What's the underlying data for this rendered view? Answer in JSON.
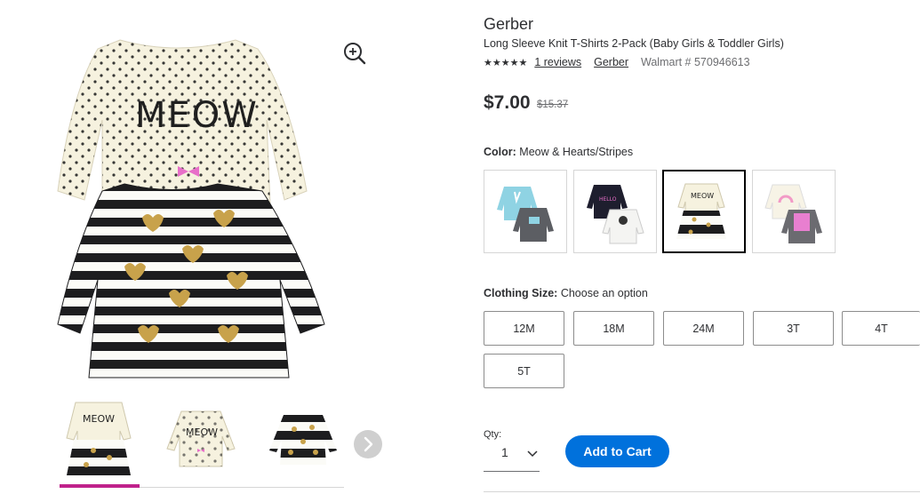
{
  "product": {
    "brand": "Gerber",
    "title": "Long Sleeve Knit T-Shirts 2-Pack (Baby Girls & Toddler Girls)",
    "stars_display": "★★★★★",
    "reviews_link": "1 reviews",
    "brand_link": "Gerber",
    "item_number": "Walmart # 570946613",
    "price": "$7.00",
    "was_price": "$15.37"
  },
  "gallery": {
    "main_image": "meow-stripes-hearts-shirts",
    "zoom_icon": "zoom-in-icon",
    "thumbnails": [
      "meow-and-stripes-pack",
      "meow-dot-shirt",
      "striped-hearts-shirt"
    ],
    "active_thumbnail": 0,
    "next_icon": "chevron-right-icon"
  },
  "color": {
    "label": "Color:",
    "value": "Meow & Hearts/Stripes",
    "options": [
      "bunny-teal-gray-pack",
      "navy-cat-white-pack",
      "meow-hearts-stripes-pack",
      "rainbow-pink-gray-pack"
    ],
    "selected_index": 2
  },
  "size": {
    "label": "Clothing Size:",
    "value": "Choose an option",
    "options": [
      "12M",
      "18M",
      "24M",
      "3T",
      "4T",
      "5T"
    ]
  },
  "quantity": {
    "label": "Qty:",
    "value": "1"
  },
  "cart": {
    "add_label": "Add to Cart"
  },
  "colors": {
    "accent_blue": "#0071dc",
    "active_thumb": "#c0218b",
    "text": "#2e2f32"
  }
}
